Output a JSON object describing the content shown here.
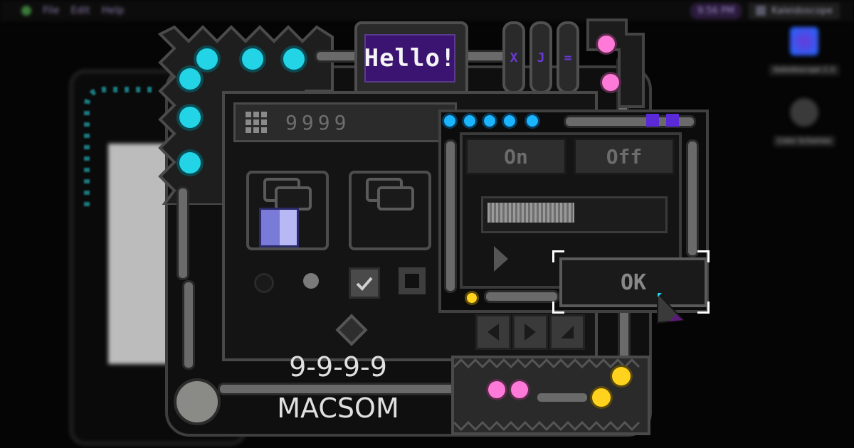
{
  "menubar": {
    "items": [
      "File",
      "Edit",
      "Help"
    ],
    "clock": "9:56 PM",
    "app_name": "Kaleidoscope"
  },
  "desktop": {
    "icons": [
      {
        "label": "Kaleidoscope 2.3"
      },
      {
        "label": "Color Schemes"
      }
    ]
  },
  "colors": {
    "accent_cyan": "#22d4e6",
    "accent_pink": "#ff7ad8",
    "accent_yellow": "#ffd21e",
    "accent_purple": "#3a1470"
  },
  "banner": {
    "text": "Hello!"
  },
  "capsules": [
    "X",
    "J",
    "="
  ],
  "window": {
    "title": "9999"
  },
  "controls": {
    "toggle_on": "On",
    "toggle_off": "Off",
    "slider_value": 0.5,
    "ok_label": "OK"
  },
  "scheme": {
    "number": "9-9-9-9",
    "name": "MACSOM"
  }
}
